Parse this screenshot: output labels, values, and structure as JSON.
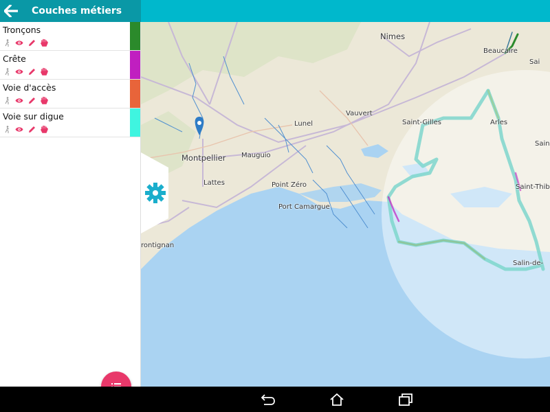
{
  "header": {
    "title": "Couches métiers"
  },
  "layers": [
    {
      "name": "Tronçons",
      "color": "#2b8a2b"
    },
    {
      "name": "Crête",
      "color": "#c01fc0"
    },
    {
      "name": "Voie d'accès",
      "color": "#e8643a"
    },
    {
      "name": "Voie sur digue",
      "color": "#3ff5e0"
    }
  ],
  "tool_icons": [
    "walk-icon",
    "eye-icon",
    "pencil-icon",
    "hand-icon"
  ],
  "colors": {
    "primary_dark": "#0a98a6",
    "primary": "#00b8cc",
    "accent": "#e8386a",
    "sea": "#aad3f2"
  },
  "map": {
    "labels": {
      "nimes": "Nimes",
      "beaucaire": "Beaucaire",
      "vauvert": "Vauvert",
      "lunel": "Lunel",
      "saint_gilles": "Saint-Gilles",
      "arles": "Arles",
      "montpellier": "Montpellier",
      "mauguio": "Mauguio",
      "lattes": "Lattes",
      "point_zero": "Point Zéro",
      "port_camargue": "Port Camargue",
      "frontignan": "rontignan",
      "saint_m": "Saint-M",
      "saint_thibery": "Saint-Thibé",
      "salin": "Salin-de-",
      "sai": "Sai"
    }
  },
  "navbar": {
    "buttons": [
      "back-nav-icon",
      "home-nav-icon",
      "recents-nav-icon"
    ]
  }
}
